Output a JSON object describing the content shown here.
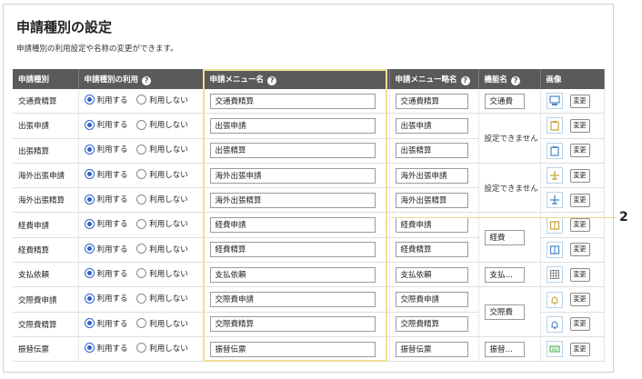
{
  "header": {
    "title": "申請種別の設定",
    "subtitle": "申請種別の利用設定や名称の変更ができます。"
  },
  "table": {
    "columns": [
      "申請種別",
      "申請種別の利用",
      "申請メニュー名",
      "申請メニュー略名",
      "機能名",
      "画像"
    ],
    "help_icon": "?",
    "radio_use": "利用する",
    "radio_nouse": "利用しない",
    "change_label": "変更",
    "rows": [
      {
        "type": "交通費精算",
        "menu": "交通費精算",
        "short": "交通費精算",
        "func": "交通費",
        "icon": "monitor-icon",
        "icon_color": "#4a86c5"
      },
      {
        "type": "出張申請",
        "menu": "出張申請",
        "short": "出張申請",
        "func": "設定できません",
        "icon": "clipboard-icon",
        "icon_color": "#c9a33a"
      },
      {
        "type": "出張精算",
        "menu": "出張精算",
        "short": "出張精算",
        "func": "",
        "icon": "clipboard-icon",
        "icon_color": "#4a86c5"
      },
      {
        "type": "海外出張申請",
        "menu": "海外出張申請",
        "short": "海外出張申請",
        "func": "設定できません",
        "icon": "airplane-icon",
        "icon_color": "#c9a33a"
      },
      {
        "type": "海外出張精算",
        "menu": "海外出張精算",
        "short": "海外出張精算",
        "func": "",
        "icon": "airplane-icon",
        "icon_color": "#4a86c5"
      },
      {
        "type": "経費申請",
        "menu": "経費申請",
        "short": "経費申請",
        "func": "経費",
        "icon": "book-icon",
        "icon_color": "#c9a33a"
      },
      {
        "type": "経費精算",
        "menu": "経費精算",
        "short": "経費精算",
        "func": "",
        "icon": "book-icon",
        "icon_color": "#4a86c5"
      },
      {
        "type": "支払依頼",
        "menu": "支払依頼",
        "short": "支払依頼",
        "func": "支払…",
        "icon": "grid-icon",
        "icon_color": "#8a8a8a"
      },
      {
        "type": "交際費申請",
        "menu": "交際費申請",
        "short": "交際費申請",
        "func": "交際費",
        "icon": "bell-icon",
        "icon_color": "#c9a33a"
      },
      {
        "type": "交際費精算",
        "menu": "交際費精算",
        "short": "交際費精算",
        "func": "",
        "icon": "bell-icon",
        "icon_color": "#4a86c5"
      },
      {
        "type": "振替伝票",
        "menu": "振替伝票",
        "short": "振替伝票",
        "func": "振替…",
        "icon": "keyboard-icon",
        "icon_color": "#4caf50"
      }
    ]
  },
  "callout": {
    "number": "2"
  }
}
